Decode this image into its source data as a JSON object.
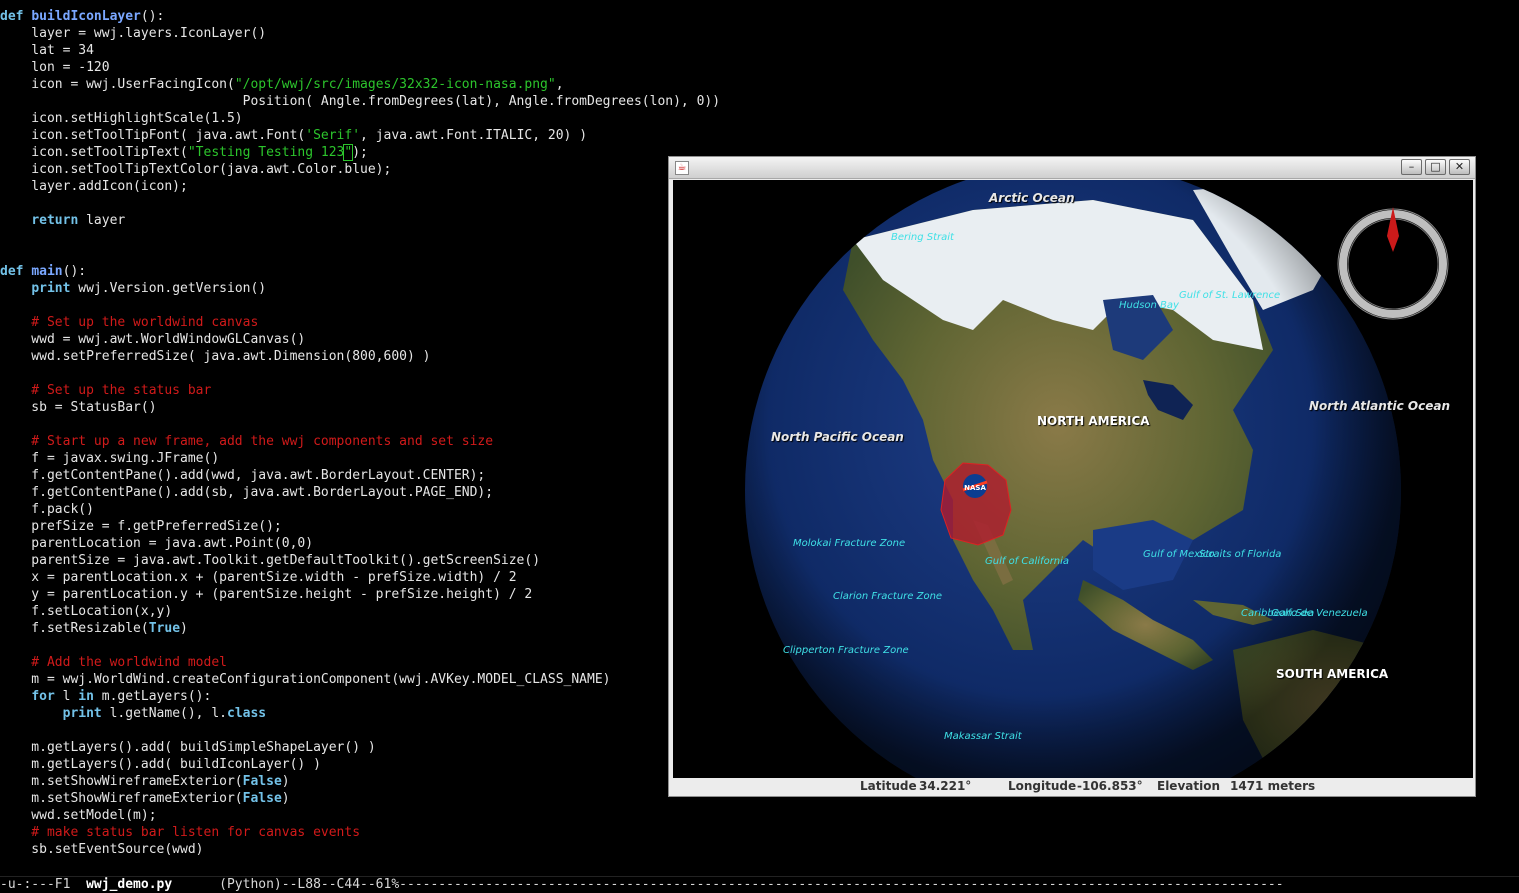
{
  "editor": {
    "lines": [
      [
        {
          "t": "def ",
          "c": "kw"
        },
        {
          "t": "buildIconLayer",
          "c": "fn"
        },
        {
          "t": "():"
        }
      ],
      [
        {
          "t": "    layer = wwj.layers.IconLayer()"
        }
      ],
      [
        {
          "t": "    lat = 34"
        }
      ],
      [
        {
          "t": "    lon = -120"
        }
      ],
      [
        {
          "t": "    icon = wwj.UserFacingIcon("
        },
        {
          "t": "\"/opt/wwj/src/images/32x32-icon-nasa.png\"",
          "c": "str"
        },
        {
          "t": ","
        }
      ],
      [
        {
          "t": "                               Position( Angle.fromDegrees(lat), Angle.fromDegrees(lon), 0))"
        }
      ],
      [
        {
          "t": "    icon.setHighlightScale(1.5)"
        }
      ],
      [
        {
          "t": "    icon.setToolTipFont( java.awt.Font("
        },
        {
          "t": "'Serif'",
          "c": "str"
        },
        {
          "t": ", java.awt.Font.ITALIC, 20) )"
        }
      ],
      [
        {
          "t": "    icon.setToolTipText("
        },
        {
          "t": "\"Testing Testing 123",
          "c": "str"
        },
        {
          "t": "\"",
          "c": "str cur"
        },
        {
          "t": ");"
        }
      ],
      [
        {
          "t": "    icon.setToolTipTextColor(java.awt.Color.blue);"
        }
      ],
      [
        {
          "t": "    layer.addIcon(icon);"
        }
      ],
      [
        {
          "t": ""
        }
      ],
      [
        {
          "t": "    "
        },
        {
          "t": "return",
          "c": "kw"
        },
        {
          "t": " layer"
        }
      ],
      [
        {
          "t": ""
        }
      ],
      [
        {
          "t": ""
        }
      ],
      [
        {
          "t": "def ",
          "c": "kw"
        },
        {
          "t": "main",
          "c": "fn"
        },
        {
          "t": "():"
        }
      ],
      [
        {
          "t": "    "
        },
        {
          "t": "print",
          "c": "kw"
        },
        {
          "t": " wwj.Version.getVersion()"
        }
      ],
      [
        {
          "t": ""
        }
      ],
      [
        {
          "t": "    # Set up the worldwind canvas",
          "c": "cm"
        }
      ],
      [
        {
          "t": "    wwd = wwj.awt.WorldWindowGLCanvas()"
        }
      ],
      [
        {
          "t": "    wwd.setPreferredSize( java.awt.Dimension(800,600) )"
        }
      ],
      [
        {
          "t": ""
        }
      ],
      [
        {
          "t": "    # Set up the status bar",
          "c": "cm"
        }
      ],
      [
        {
          "t": "    sb = StatusBar()"
        }
      ],
      [
        {
          "t": ""
        }
      ],
      [
        {
          "t": "    # Start up a new frame, add the wwj components and set size",
          "c": "cm"
        }
      ],
      [
        {
          "t": "    f = javax.swing.JFrame()"
        }
      ],
      [
        {
          "t": "    f.getContentPane().add(wwd, java.awt.BorderLayout.CENTER);"
        }
      ],
      [
        {
          "t": "    f.getContentPane().add(sb, java.awt.BorderLayout.PAGE_END);"
        }
      ],
      [
        {
          "t": "    f.pack()"
        }
      ],
      [
        {
          "t": "    prefSize = f.getPreferredSize();"
        }
      ],
      [
        {
          "t": "    parentLocation = java.awt.Point(0,0)"
        }
      ],
      [
        {
          "t": "    parentSize = java.awt.Toolkit.getDefaultToolkit().getScreenSize()"
        }
      ],
      [
        {
          "t": "    x = parentLocation.x + (parentSize.width - prefSize.width) / 2"
        }
      ],
      [
        {
          "t": "    y = parentLocation.y + (parentSize.height - prefSize.height) / 2"
        }
      ],
      [
        {
          "t": "    f.setLocation(x,y)"
        }
      ],
      [
        {
          "t": "    f.setResizable("
        },
        {
          "t": "True",
          "c": "kw"
        },
        {
          "t": ")"
        }
      ],
      [
        {
          "t": ""
        }
      ],
      [
        {
          "t": "    # Add the worldwind model",
          "c": "cm"
        }
      ],
      [
        {
          "t": "    m = wwj.WorldWind.createConfigurationComponent(wwj.AVKey.MODEL_CLASS_NAME)"
        }
      ],
      [
        {
          "t": "    "
        },
        {
          "t": "for",
          "c": "kw"
        },
        {
          "t": " l "
        },
        {
          "t": "in",
          "c": "kw"
        },
        {
          "t": " m.getLayers():"
        }
      ],
      [
        {
          "t": "        "
        },
        {
          "t": "print",
          "c": "kw"
        },
        {
          "t": " l.getName(), l."
        },
        {
          "t": "class",
          "c": "kw"
        }
      ],
      [
        {
          "t": ""
        }
      ],
      [
        {
          "t": "    m.getLayers().add( buildSimpleShapeLayer() )"
        }
      ],
      [
        {
          "t": "    m.getLayers().add( buildIconLayer() )"
        }
      ],
      [
        {
          "t": "    m.setShowWireframeExterior("
        },
        {
          "t": "False",
          "c": "kw"
        },
        {
          "t": ")"
        }
      ],
      [
        {
          "t": "    m.setShowWireframeExterior("
        },
        {
          "t": "False",
          "c": "kw"
        },
        {
          "t": ")"
        }
      ],
      [
        {
          "t": "    wwd.setModel(m);"
        }
      ],
      [
        {
          "t": "    # make status bar listen for canvas events",
          "c": "cm"
        }
      ],
      [
        {
          "t": "    sb.setEventSource(wwd)"
        }
      ]
    ]
  },
  "modeline": {
    "prefix": "-u-:---F1  ",
    "filename": "wwj_demo.py",
    "rest": "      (Python)--L88--C44--61%-----------------------------------------------------------------------------------------------------------------"
  },
  "window": {
    "min_glyph": "–",
    "max_glyph": "□",
    "close_glyph": "✕"
  },
  "globe": {
    "labels": {
      "arctic": "Arctic Ocean",
      "bering": "Bering Strait",
      "hudson": "Hudson Bay",
      "stlawrence": "Gulf of St. Lawrence",
      "north_america": "NORTH AMERICA",
      "north_atlantic": "North Atlantic Ocean",
      "north_pacific": "North Pacific Ocean",
      "molokai": "Molokai Fracture Zone",
      "gulf_california": "Gulf of California",
      "gulf_mexico": "Gulf of Mexico",
      "straits_florida": "Straits of Florida",
      "clarion": "Clarion Fracture Zone",
      "caribbean": "Caribbean Sea",
      "venezuela": "Golfo de Venezuela",
      "clipperton": "Clipperton Fracture Zone",
      "south_america": "SOUTH AMERICA",
      "makassar": "Makassar Strait"
    },
    "nasa_icon_text": "NASA"
  },
  "status": {
    "latitude_label": "Latitude",
    "latitude_value": "34.221°",
    "longitude_label": "Longitude",
    "longitude_value": "-106.853°",
    "elevation_label": "Elevation",
    "elevation_value": "1471 meters"
  }
}
